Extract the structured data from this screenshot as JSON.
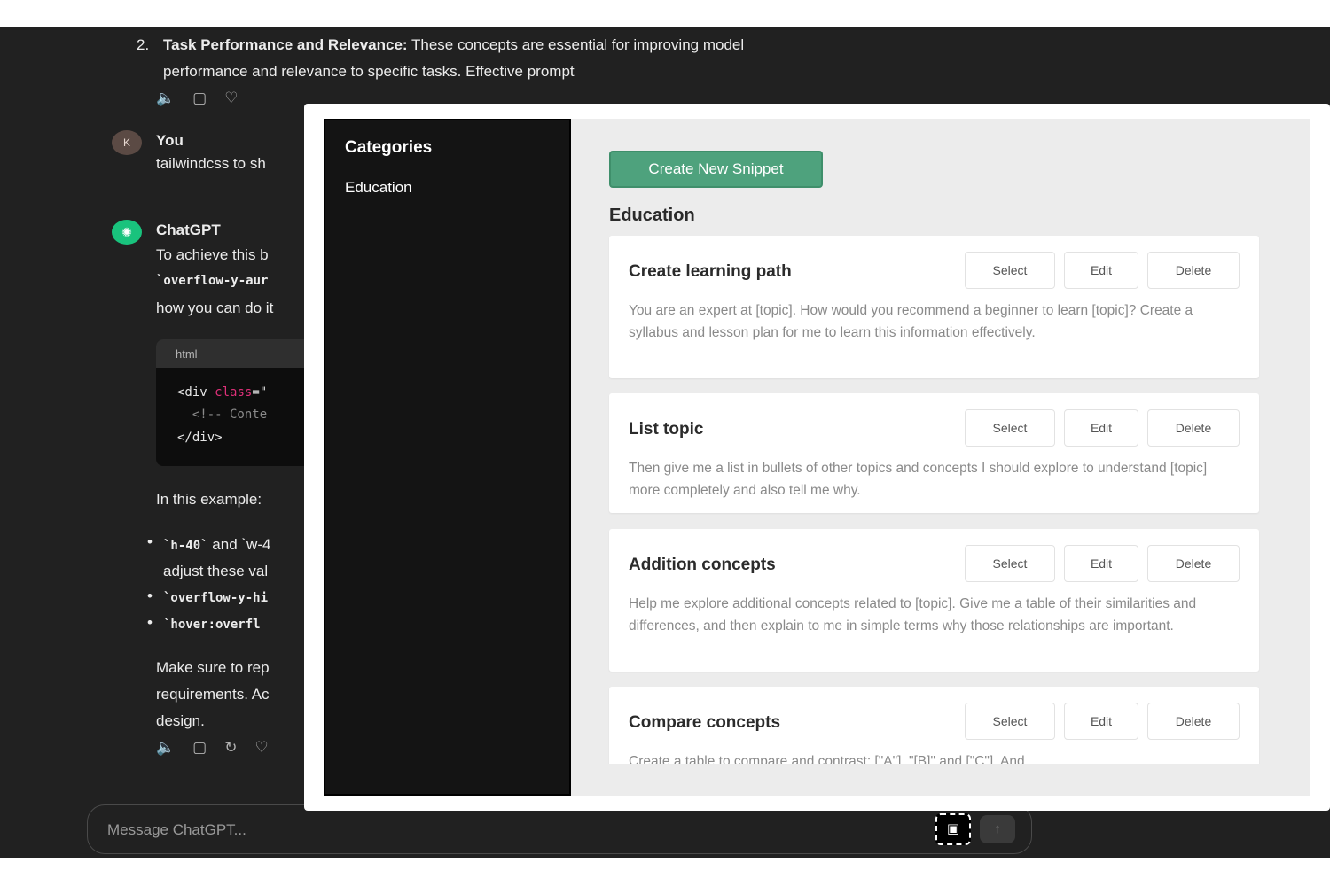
{
  "chat": {
    "list_item_number": "2.",
    "list_item_bold": "Task Performance and Relevance:",
    "list_item_text": " These concepts are essential for improving model",
    "list_item_line2": "performance and relevance to specific tasks. Effective prompt",
    "user_avatar": "K",
    "user_name": "You",
    "user_message": "tailwindcss to sh",
    "assistant_name": "ChatGPT",
    "reply_line1": "To achieve this b",
    "reply_line2_code": "`overflow-y-aur",
    "reply_line3": "how you can do it",
    "code_lang": "html",
    "code_line1_a": "<div ",
    "code_line1_kw": "class",
    "code_line1_b": "=\"",
    "code_line2": "  <!-- Conte",
    "code_line3": "</div>",
    "example_heading": "In this example:",
    "bullet1_code": "`h-40`",
    "bullet1_text": " and `w-4",
    "bullet1_line2": "adjust these val",
    "bullet2_code": "`overflow-y-hi",
    "bullet3_code": "`hover:overfl",
    "closing_line1": "Make sure to rep",
    "closing_line2": "requirements. Ac",
    "closing_line3": "design.",
    "composer_placeholder": "Message ChatGPT..."
  },
  "icons": {
    "speaker": "speaker-icon",
    "copy": "copy-icon",
    "thumbs_down": "thumbs-down-icon",
    "regenerate": "regenerate-icon",
    "snippet": "snippet-icon",
    "send": "arrow-up-icon"
  },
  "modal": {
    "categories_title": "Categories",
    "categories": [
      "Education"
    ],
    "create_button": "Create New Snippet",
    "section_title": "Education",
    "action_labels": {
      "select": "Select",
      "edit": "Edit",
      "delete": "Delete"
    },
    "snippets": [
      {
        "title": "Create learning path",
        "body": "You are an expert at [topic]. How would you recommend a beginner to learn [topic]? Create a syllabus and lesson plan for me to learn this information effectively."
      },
      {
        "title": "List topic",
        "body": "Then give me a list in bullets of other topics and concepts I should explore to understand [topic] more completely and also tell me why."
      },
      {
        "title": "Addition concepts",
        "body": "Help me explore additional concepts related to [topic]. Give me a table of their similarities and differences, and then explain to me in simple terms why those relationships are important."
      },
      {
        "title": "Compare concepts",
        "body": "Create a table to compare and contrast: [\"A\"], \"[B]\" and [\"C\"]. And"
      }
    ]
  },
  "colors": {
    "chat_bg": "#212121",
    "accent_green": "#4ea27d",
    "modal_panel": "#ececec",
    "sidebar_bg": "#141414"
  }
}
